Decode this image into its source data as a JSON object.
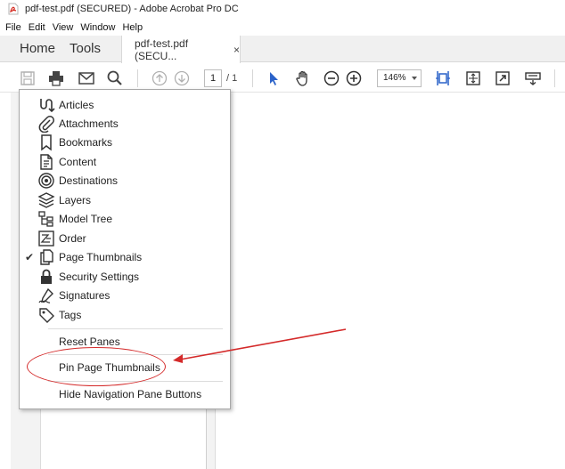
{
  "window": {
    "title": "pdf-test.pdf (SECURED) - Adobe Acrobat Pro DC"
  },
  "menubar": {
    "items": [
      "File",
      "Edit",
      "View",
      "Window",
      "Help"
    ]
  },
  "tabs": {
    "home": "Home",
    "tools": "Tools",
    "document": "pdf-test.pdf (SECU...",
    "close": "×"
  },
  "toolbar": {
    "page_current": "1",
    "page_total": "/ 1",
    "zoom": "146%",
    "icons": [
      "save-icon",
      "print-icon",
      "email-icon",
      "search-icon",
      "prev-page-icon",
      "next-page-icon",
      "select-tool-icon",
      "hand-tool-icon",
      "zoom-out-icon",
      "zoom-in-icon",
      "fit-page-icon",
      "scroll-mode-icon",
      "full-screen-icon",
      "read-mode-icon"
    ]
  },
  "colors": {
    "accent_blue": "#2a62c9",
    "annotation_red": "#d42a2a"
  },
  "dropdown": {
    "items": [
      {
        "label": "Articles",
        "icon": "articles-icon",
        "checked": false
      },
      {
        "label": "Attachments",
        "icon": "attachments-icon",
        "checked": false
      },
      {
        "label": "Bookmarks",
        "icon": "bookmarks-icon",
        "checked": false
      },
      {
        "label": "Content",
        "icon": "content-icon",
        "checked": false
      },
      {
        "label": "Destinations",
        "icon": "destinations-icon",
        "checked": false
      },
      {
        "label": "Layers",
        "icon": "layers-icon",
        "checked": false
      },
      {
        "label": "Model Tree",
        "icon": "model-tree-icon",
        "checked": false
      },
      {
        "label": "Order",
        "icon": "order-icon",
        "checked": false
      },
      {
        "label": "Page Thumbnails",
        "icon": "page-thumbnails-icon",
        "checked": true
      },
      {
        "label": "Security Settings",
        "icon": "lock-icon",
        "checked": false
      },
      {
        "label": "Signatures",
        "icon": "signatures-icon",
        "checked": false
      },
      {
        "label": "Tags",
        "icon": "tags-icon",
        "checked": false
      }
    ],
    "check_mark": "✔",
    "reset_panes": "Reset Panes",
    "pin_page_thumbnails": "Pin Page Thumbnails",
    "hide_nav_buttons": "Hide Navigation Pane Buttons"
  }
}
